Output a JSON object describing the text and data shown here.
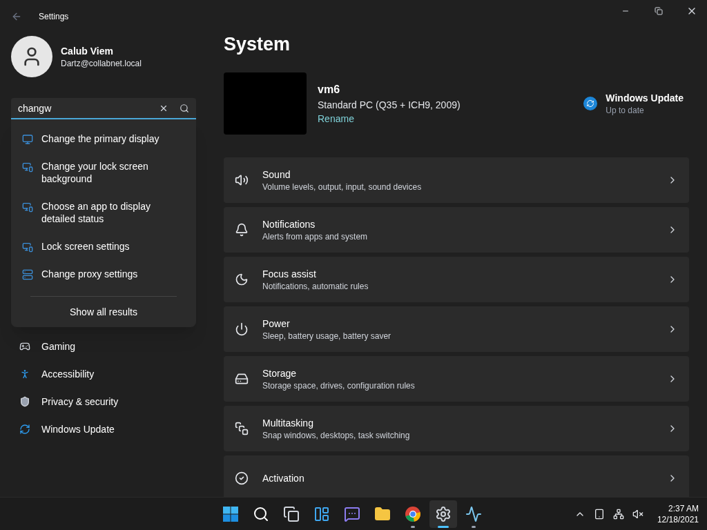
{
  "window": {
    "title": "Settings"
  },
  "account": {
    "name": "Calub Viem",
    "email": "Dartz@collabnet.local"
  },
  "search": {
    "value": "changw"
  },
  "search_results": [
    {
      "label": "Change the primary display",
      "kind": "display"
    },
    {
      "label": "Change your lock screen background",
      "kind": "lock"
    },
    {
      "label": "Choose an app to display detailed status",
      "kind": "lock"
    },
    {
      "label": "Lock screen settings",
      "kind": "lock"
    },
    {
      "label": "Change proxy settings",
      "kind": "proxy"
    }
  ],
  "show_all": "Show all results",
  "sidebar": {
    "items": [
      {
        "label": "Gaming",
        "kind": "gaming",
        "selected": false
      },
      {
        "label": "Accessibility",
        "kind": "accessibility",
        "selected": false
      },
      {
        "label": "Privacy & security",
        "kind": "privacy",
        "selected": false
      },
      {
        "label": "Windows Update",
        "kind": "update",
        "selected": false
      }
    ]
  },
  "page_title": "System",
  "device": {
    "name": "vm6",
    "model": "Standard PC (Q35 + ICH9, 2009)",
    "rename": "Rename"
  },
  "update_status": {
    "title": "Windows Update",
    "subtitle": "Up to date"
  },
  "settings": [
    {
      "kind": "sound",
      "title": "Sound",
      "subtitle": "Volume levels, output, input, sound devices"
    },
    {
      "kind": "notifications",
      "title": "Notifications",
      "subtitle": "Alerts from apps and system"
    },
    {
      "kind": "focus",
      "title": "Focus assist",
      "subtitle": "Notifications, automatic rules"
    },
    {
      "kind": "power",
      "title": "Power",
      "subtitle": "Sleep, battery usage, battery saver"
    },
    {
      "kind": "storage",
      "title": "Storage",
      "subtitle": "Storage space, drives, configuration rules"
    },
    {
      "kind": "multitasking",
      "title": "Multitasking",
      "subtitle": "Snap windows, desktops, task switching"
    },
    {
      "kind": "activation",
      "title": "Activation"
    }
  ],
  "taskbar": {
    "apps": [
      {
        "kind": "start",
        "running": false,
        "selected": false
      },
      {
        "kind": "search",
        "running": false,
        "selected": false
      },
      {
        "kind": "taskview",
        "running": false,
        "selected": false
      },
      {
        "kind": "widgets",
        "running": false,
        "selected": false
      },
      {
        "kind": "chat",
        "running": false,
        "selected": false
      },
      {
        "kind": "explorer",
        "running": false,
        "selected": false
      },
      {
        "kind": "chrome",
        "running": true,
        "selected": false
      },
      {
        "kind": "settings",
        "running": true,
        "selected": true
      },
      {
        "kind": "monitor",
        "running": true,
        "selected": false
      }
    ],
    "time": "2:37 AM",
    "date": "12/18/2021"
  }
}
